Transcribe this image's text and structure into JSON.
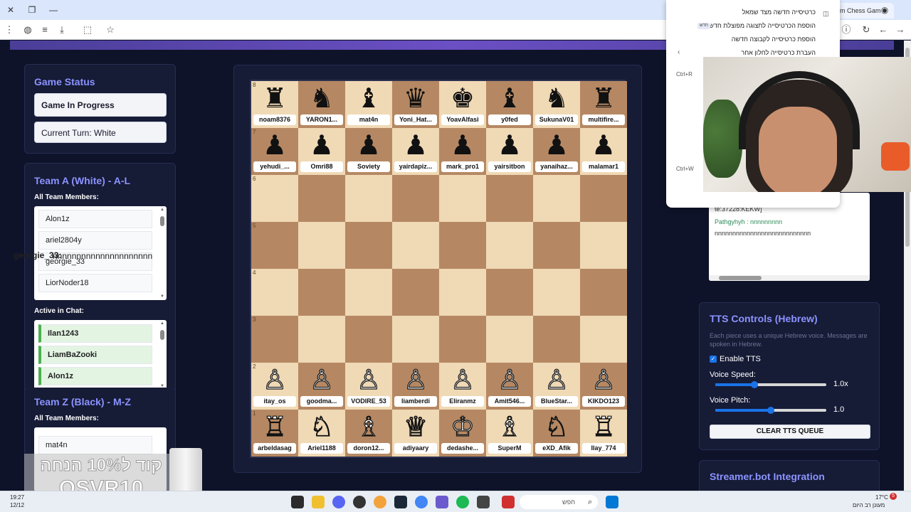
{
  "browser": {
    "tab_partial": "m Chess Gam",
    "context_menu": {
      "items": [
        "כרטיסייה חדשה מצד שמאל",
        "הוספת הכרטיסייה לתצוגה מפוצלת חדשה",
        "הוספת כרטיסייה לקבוצה חדשה",
        "העברת כרטיסייה לחלון אחר"
      ],
      "badge": "חדש",
      "shortcuts": [
        "Ctrl+R",
        "Ctrl+W"
      ]
    }
  },
  "game_status": {
    "title": "Game Status",
    "state": "Game In Progress",
    "turn": "Current Turn: White"
  },
  "team_a": {
    "title": "Team A (White) - A-L",
    "members_label": "All Team Members:",
    "members": [
      "Alon1z",
      "ariel2804y",
      "georgie_33",
      "LiorNoder18"
    ],
    "chat_label": "Active in Chat:",
    "chat_active": [
      "Ilan1243",
      "LiamBaZooki",
      "Alon1z"
    ]
  },
  "team_z": {
    "title": "Team Z (Black) - M-Z",
    "members_label": "All Team Members:",
    "members": [
      "mat4n"
    ]
  },
  "board": {
    "rank_labels": [
      "8",
      "7",
      "6",
      "5",
      "4",
      "3",
      "2",
      "1"
    ],
    "rank8": [
      {
        "piece": "♜",
        "name": "noam8376"
      },
      {
        "piece": "♞",
        "name": "YARON1..."
      },
      {
        "piece": "♝",
        "name": "mat4n"
      },
      {
        "piece": "♛",
        "name": "Yoni_Hat..."
      },
      {
        "piece": "♚",
        "name": "YoavAlfasi"
      },
      {
        "piece": "♝",
        "name": "y0fed"
      },
      {
        "piece": "♞",
        "name": "SukunaV01"
      },
      {
        "piece": "♜",
        "name": "multifire..."
      }
    ],
    "rank7": [
      {
        "piece": "♟",
        "name": "yehudi_..."
      },
      {
        "piece": "♟",
        "name": "Omri88"
      },
      {
        "piece": "♟",
        "name": "Soviety"
      },
      {
        "piece": "♟",
        "name": "yairdapiz..."
      },
      {
        "piece": "♟",
        "name": "mark_pro1"
      },
      {
        "piece": "♟",
        "name": "yairsitbon"
      },
      {
        "piece": "♟",
        "name": "yanaihaz..."
      },
      {
        "piece": "♟",
        "name": "malamar1"
      }
    ],
    "rank2": [
      {
        "piece": "♙",
        "name": "itay_os"
      },
      {
        "piece": "♙",
        "name": "goodma..."
      },
      {
        "piece": "♙",
        "name": "VODIRE_53"
      },
      {
        "piece": "♙",
        "name": "liamberdi"
      },
      {
        "piece": "♙",
        "name": "Eliranmz"
      },
      {
        "piece": "♙",
        "name": "Amit546..."
      },
      {
        "piece": "♙",
        "name": "BlueStar..."
      },
      {
        "piece": "♙",
        "name": "KIKDO123"
      }
    ],
    "rank1": [
      {
        "piece": "♖",
        "name": "arbeldasag"
      },
      {
        "piece": "♘",
        "name": "Ariel1188"
      },
      {
        "piece": "♗",
        "name": "doron12..."
      },
      {
        "piece": "♕",
        "name": "adiyaary"
      },
      {
        "piece": "♔",
        "name": "dedashe..."
      },
      {
        "piece": "♗",
        "name": "SuperM"
      },
      {
        "piece": "♘",
        "name": "eXD_Afik"
      },
      {
        "piece": "♖",
        "name": "Ilay_774"
      }
    ]
  },
  "chat": {
    "lines": [
      "te:37228:KEKW]",
      "Pathgyhyh : nnnnnnnnn",
      "nnnnnnnnnnnnnnnnnnnnnnnnnnn"
    ],
    "last_user": "georgie_33:",
    "last_text": "nnnnnnnnnnnnnnnnnnnnn"
  },
  "tts": {
    "title": "TTS Controls (Hebrew)",
    "description": "Each piece uses a unique Hebrew voice. Messages are spoken in Hebrew.",
    "enable_label": "Enable TTS",
    "speed_label": "Voice Speed:",
    "speed_value": "1.0x",
    "speed_fraction": 0.35,
    "pitch_label": "Voice Pitch:",
    "pitch_value": "1.0",
    "pitch_fraction": 0.5,
    "clear_label": "CLEAR TTS QUEUE"
  },
  "streamerbot": {
    "title": "Streamer.bot Integration"
  },
  "promo": {
    "line1": "קוד ל10% הנחה",
    "line2": "OSVR10"
  },
  "taskbar": {
    "time": "19:27",
    "date": "12/12",
    "search_placeholder": "חפש",
    "temp": "17°C",
    "weather": "מעונן רב היום",
    "notif_count": "5"
  },
  "colors": {
    "accent": "#8b93ff",
    "light_square": "#f0d9b5",
    "dark_square": "#b58863",
    "panel_bg": "#161b36"
  }
}
